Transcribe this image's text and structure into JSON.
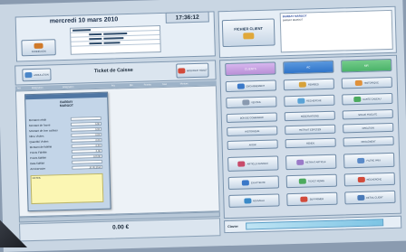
{
  "header": {
    "date": "mercredi 10 mars 2010",
    "time": "17:36:12",
    "client_file_label": "FICHIER CLIENT",
    "client_name": "BARBAY MARGOT",
    "client_sub": "BARBAY MARGOT"
  },
  "ticket": {
    "title": "Ticket de Caisse",
    "total": "0.00 €",
    "columns": [
      "Réf.",
      "Désignation",
      "Désignation",
      "Prix",
      "Qté",
      "Remise",
      "Total",
      "Montant"
    ]
  },
  "client_card": {
    "name": "BARBAY",
    "firstname": "MARGOT",
    "fields": [
      {
        "label": "Montant crédit",
        "value": ""
      },
      {
        "label": "Montant de l'avoir",
        "value": "0.00"
      },
      {
        "label": "Montant de bon cadeau",
        "value": "0.00"
      },
      {
        "label": "Nbre Visites",
        "value": "0.00"
      },
      {
        "label": "Quantité Visites",
        "value": "0.00"
      },
      {
        "label": "Montant de fidélité",
        "value": "0.00"
      },
      {
        "label": "Points Fidélité",
        "value": "0.00"
      },
      {
        "label": "Points fidélité",
        "value": "100.00"
      },
      {
        "label": "Date fidélité",
        "value": ""
      },
      {
        "label": "Anniversaire",
        "value": "10.02.2010"
      }
    ],
    "notes_label": "NOTES"
  },
  "top_left_button": "CONNEXION",
  "ticket_side_buttons": [
    "ANNULATION",
    "MODIFIER TICKET"
  ],
  "tabs": [
    "CLIENTS",
    "AC",
    "MR"
  ],
  "function_buttons": [
    [
      "ENCAISSEMENT",
      "REMISES",
      "HISTORIQUE"
    ],
    [
      "VENTES",
      "RECHERCHE",
      "CARTE CADEAU"
    ],
    [
      "BON DE COMMANDE",
      "RESERVATIONS",
      "SOLDE FIDELITE"
    ],
    [
      "HISTORIQUE",
      "RETRAIT ESPECES",
      "CREATION"
    ],
    [
      "AVOIR",
      "RENDU",
      "REGLEMENT"
    ],
    [
      "ARTICLE INVENDU",
      "RETRAIT ARTICLE",
      "FILTRE PRIX"
    ],
    [
      "EN ATTENTE",
      "TICKET REMIS",
      "RECHERCHE"
    ],
    [
      "NOUVEAU",
      "SUPPRIMER",
      "DETAIL CLIENT"
    ]
  ],
  "status_label": "Clavier",
  "colors": {
    "tab_active": "#b98fd6",
    "tab_blue": "#2f74c9",
    "tab_green": "#4bb36a",
    "header_bar": "#d8e3ee"
  }
}
